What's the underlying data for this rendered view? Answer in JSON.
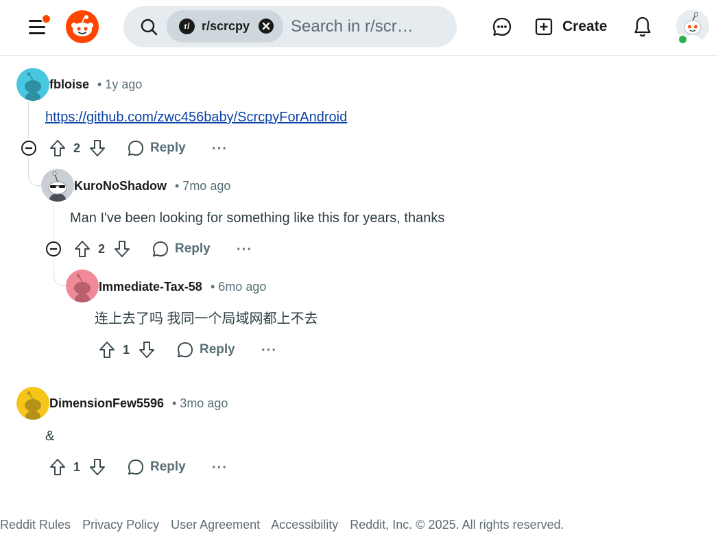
{
  "header": {
    "subreddit_chip": "r/scrcpy",
    "subreddit_chip_icon": "r/",
    "search_placeholder": "Search in r/scr…",
    "create_label": "Create",
    "icons": [
      "menu-icon",
      "reddit-logo",
      "search-icon",
      "close-icon",
      "chat-icon",
      "plus-square-icon",
      "bell-icon",
      "avatar"
    ],
    "accent_color": "#ff4500"
  },
  "comments": [
    {
      "author": "fbloise",
      "age": "• 1y ago",
      "body": "https://github.com/zwc456baby/ScrcpyForAndroid",
      "votes": "2",
      "reply_label": "Reply",
      "more_label": "···",
      "avatar_color": "#47c7e0"
    },
    {
      "author": "KuroNoShadow",
      "age": "• 7mo ago",
      "body": "Man I've been looking for something like this for years, thanks",
      "votes": "2",
      "reply_label": "Reply",
      "more_label": "···",
      "avatar_color": "#c9cfd4"
    },
    {
      "author": "Immediate-Tax-58",
      "age": "• 6mo ago",
      "body": "连上去了吗 我同一个局域网都上不去",
      "votes": "1",
      "reply_label": "Reply",
      "more_label": "···",
      "avatar_color": "#f08a98"
    },
    {
      "author": "DimensionFew5596",
      "age": "• 3mo ago",
      "body": "&",
      "votes": "1",
      "reply_label": "Reply",
      "more_label": "···",
      "avatar_color": "#f5c518"
    }
  ],
  "footer": {
    "links": [
      "Reddit Rules",
      "Privacy Policy",
      "User Agreement",
      "Accessibility"
    ],
    "copyright": "Reddit, Inc. © 2025. All rights reserved."
  }
}
